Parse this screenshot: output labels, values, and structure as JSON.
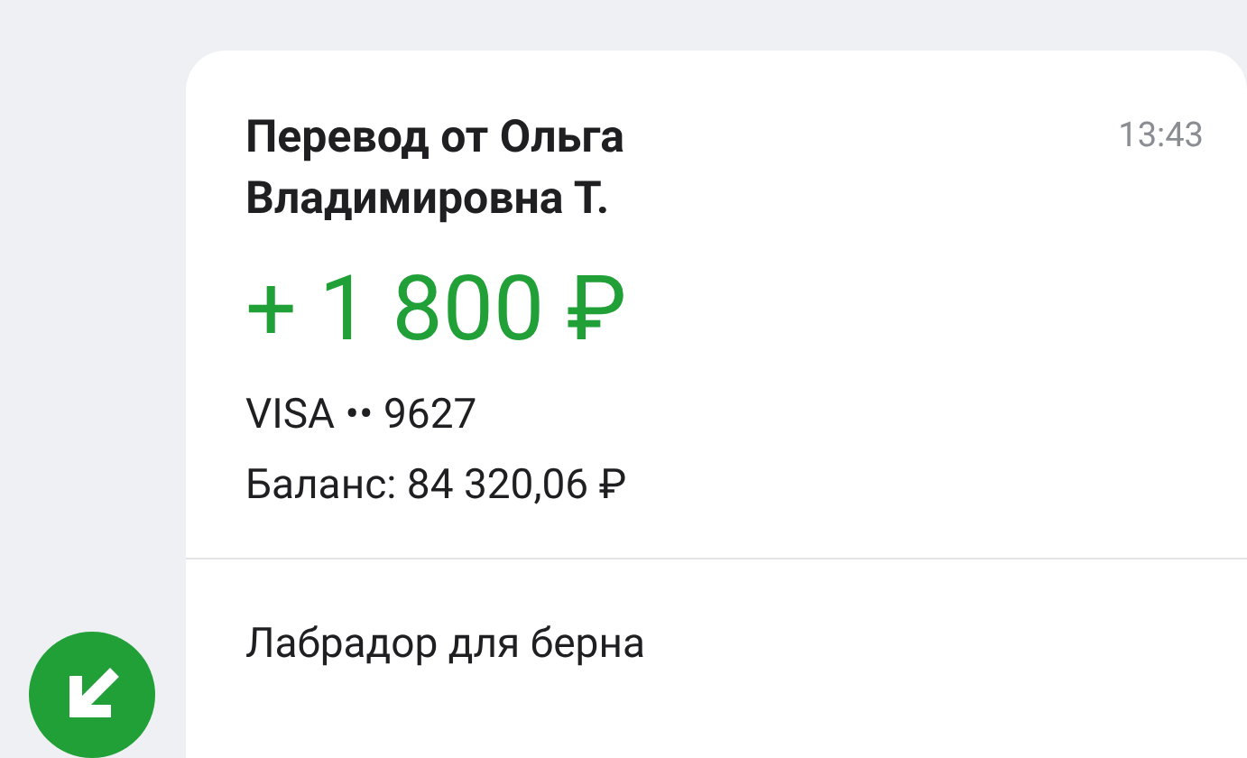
{
  "message": {
    "title": "Перевод от Ольга Владимировна Т.",
    "time": "13:43",
    "amount": "+ 1 800 ₽",
    "card": "VISA •• 9627",
    "balance": "Баланс: 84 320,06 ₽",
    "comment": "Лабрадор для берна"
  }
}
